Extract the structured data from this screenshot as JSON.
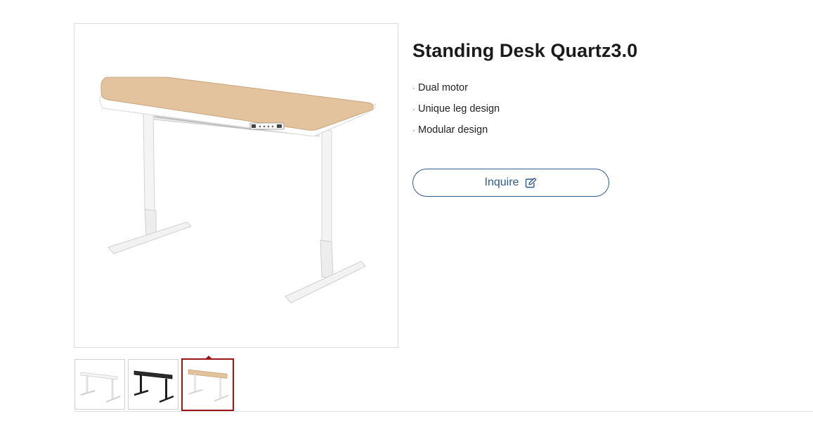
{
  "product": {
    "title": "Standing Desk Quartz3.0",
    "features": [
      "Dual motor",
      "Unique leg design",
      "Modular design"
    ],
    "bullet": "·",
    "inquire_label": "Inquire",
    "inquire_icon": "edit-icon"
  },
  "gallery": {
    "main_image": {
      "variant": "wood",
      "top_color": "#E3C29E",
      "frame_color": "#FFFFFF"
    },
    "thumbnails": [
      {
        "variant": "white",
        "top_color": "#F4F4F4",
        "frame_color": "#FFFFFF",
        "selected": false
      },
      {
        "variant": "black",
        "top_color": "#2B2B2B",
        "frame_color": "#1E1E1E",
        "selected": false
      },
      {
        "variant": "wood",
        "top_color": "#E3C29E",
        "frame_color": "#FFFFFF",
        "selected": true
      }
    ]
  },
  "colors": {
    "accent_blue": "#2E5A86",
    "selected_border": "#9A1616"
  }
}
